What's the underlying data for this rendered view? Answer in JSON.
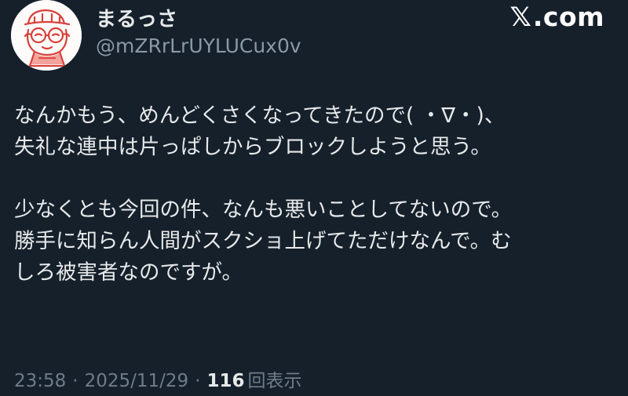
{
  "author": {
    "display_name": "まるっさ",
    "handle": "@mZRrLrUYLUCux0v"
  },
  "brand": {
    "x_glyph": "𝕏",
    "domain": ".com"
  },
  "tweet": {
    "paragraphs": [
      "なんかもう、めんどくさくなってきたので( ・∇・)、\n失礼な連中は片っぱしからブロックしようと思う。",
      "少なくとも今回の件、なんも悪いことしてないので。\n勝手に知らん人間がスクショ上げてただけなんで。む\nしろ被害者なのですが。"
    ]
  },
  "meta": {
    "time": "23:58",
    "separator": "·",
    "date": "2025/11/29",
    "views_count": "116",
    "views_label": "回表示"
  },
  "colors": {
    "background": "#15202b",
    "text": "#e7e9ea",
    "secondary": "#8b98a5",
    "avatar_ink": "#d9403a"
  },
  "icons": {
    "avatar": "cartoon-face-avatar",
    "brand": "x-logo-icon"
  }
}
